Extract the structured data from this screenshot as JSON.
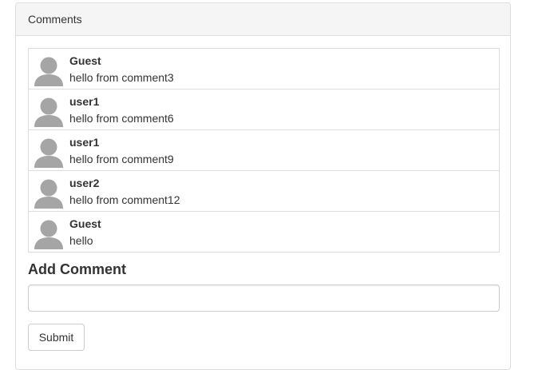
{
  "panel": {
    "heading": "Comments"
  },
  "comments": [
    {
      "author": "Guest",
      "text": "hello from comment3"
    },
    {
      "author": "user1",
      "text": "hello from comment6"
    },
    {
      "author": "user1",
      "text": "hello from comment9"
    },
    {
      "author": "user2",
      "text": "hello from comment12"
    },
    {
      "author": "Guest",
      "text": "hello"
    }
  ],
  "add_comment": {
    "title": "Add Comment",
    "input_value": "",
    "submit_label": "Submit"
  },
  "icons": {
    "avatar": "user-silhouette-icon"
  },
  "colors": {
    "avatar": "#a5a5a5",
    "heading_bg": "#f5f5f5",
    "border": "#dddddd"
  }
}
